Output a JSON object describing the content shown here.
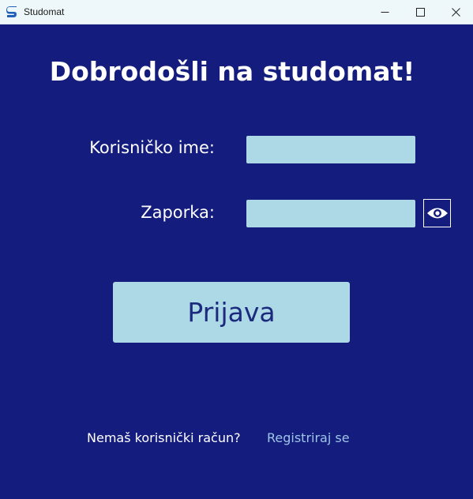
{
  "window": {
    "title": "Studomat",
    "icon": "studomat-logo-icon",
    "controls": [
      "minimize-icon",
      "maximize-icon",
      "close-icon"
    ]
  },
  "main": {
    "heading": "Dobrodošli na studomat!",
    "username_label": "Korisničko ime:",
    "username_value": "",
    "password_label": "Zaporka:",
    "password_value": "",
    "show_password_icon": "eye-icon",
    "login_button": "Prijava",
    "no_account_text": "Nemaš korisnički račun?",
    "register_link": "Registriraj se"
  },
  "colors": {
    "background": "#141c7d",
    "field": "#add8e6",
    "button": "#add8e6",
    "button_text": "#1c2a7e",
    "link": "#9ec5e6",
    "text": "#ffffff"
  }
}
